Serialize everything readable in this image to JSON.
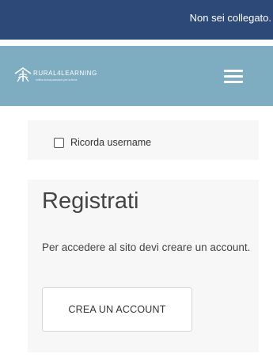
{
  "topbar": {
    "status_text": "Non sei collegato."
  },
  "navbar": {
    "logo_name": "RURAL4LEARNING",
    "logo_tagline": "coltiva la tua passione per la terra",
    "menu_icon": "hamburger-menu-icon"
  },
  "login": {
    "remember_label": "Ricorda username",
    "remember_checked": false
  },
  "register": {
    "title": "Registrati",
    "description": "Per accedere al sito devi creare un account.",
    "button_label": "CREA UN ACCOUNT"
  },
  "colors": {
    "topbar_bg": "#2c4977",
    "navbar_bg": "#7eacc0",
    "card_bg": "#f7f7f7"
  }
}
